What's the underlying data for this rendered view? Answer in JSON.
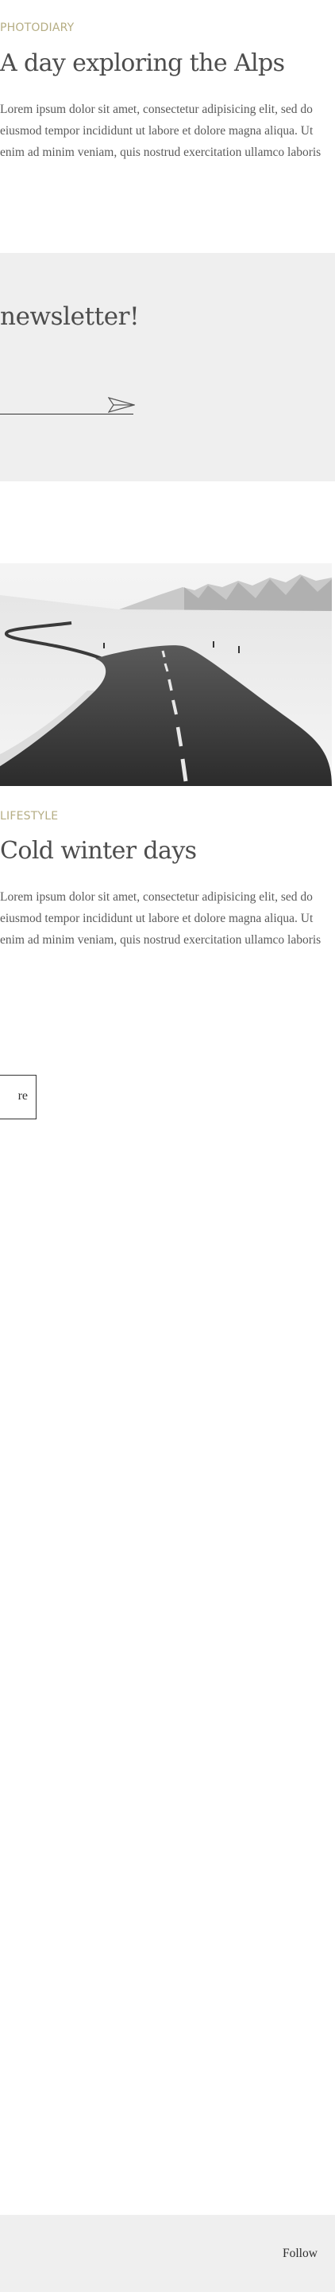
{
  "posts": [
    {
      "category": "PHOTODIARY",
      "title": "A day exploring the Alps",
      "excerpt_lines": [
        "Lorem ipsum dolor sit amet, consectetur adipisicing elit, sed do",
        "eiusmod tempor incididunt ut labore et dolore magna aliqua. Ut",
        "enim ad minim veniam, quis nostrud exercitation ullamco laboris"
      ]
    },
    {
      "category": "LIFESTYLE",
      "title": "Cold winter days",
      "excerpt_lines": [
        "Lorem ipsum dolor sit amet, consectetur adipisicing elit, sed do",
        "eiusmod tempor incididunt ut labore et dolore magna aliqua. Ut",
        "enim ad minim veniam, quis nostrud exercitation ullamco laboris"
      ],
      "read_more_label": "re"
    }
  ],
  "newsletter": {
    "heading": "newsletter!",
    "input_value": "",
    "send_icon": "paper-plane-icon"
  },
  "image": {
    "subject": "snowy-mountain-road"
  },
  "footer": {
    "follow_label": "Follow"
  },
  "colors": {
    "category": "#b5ad83",
    "panel_bg": "#efefef",
    "text": "#4d4d4d"
  }
}
